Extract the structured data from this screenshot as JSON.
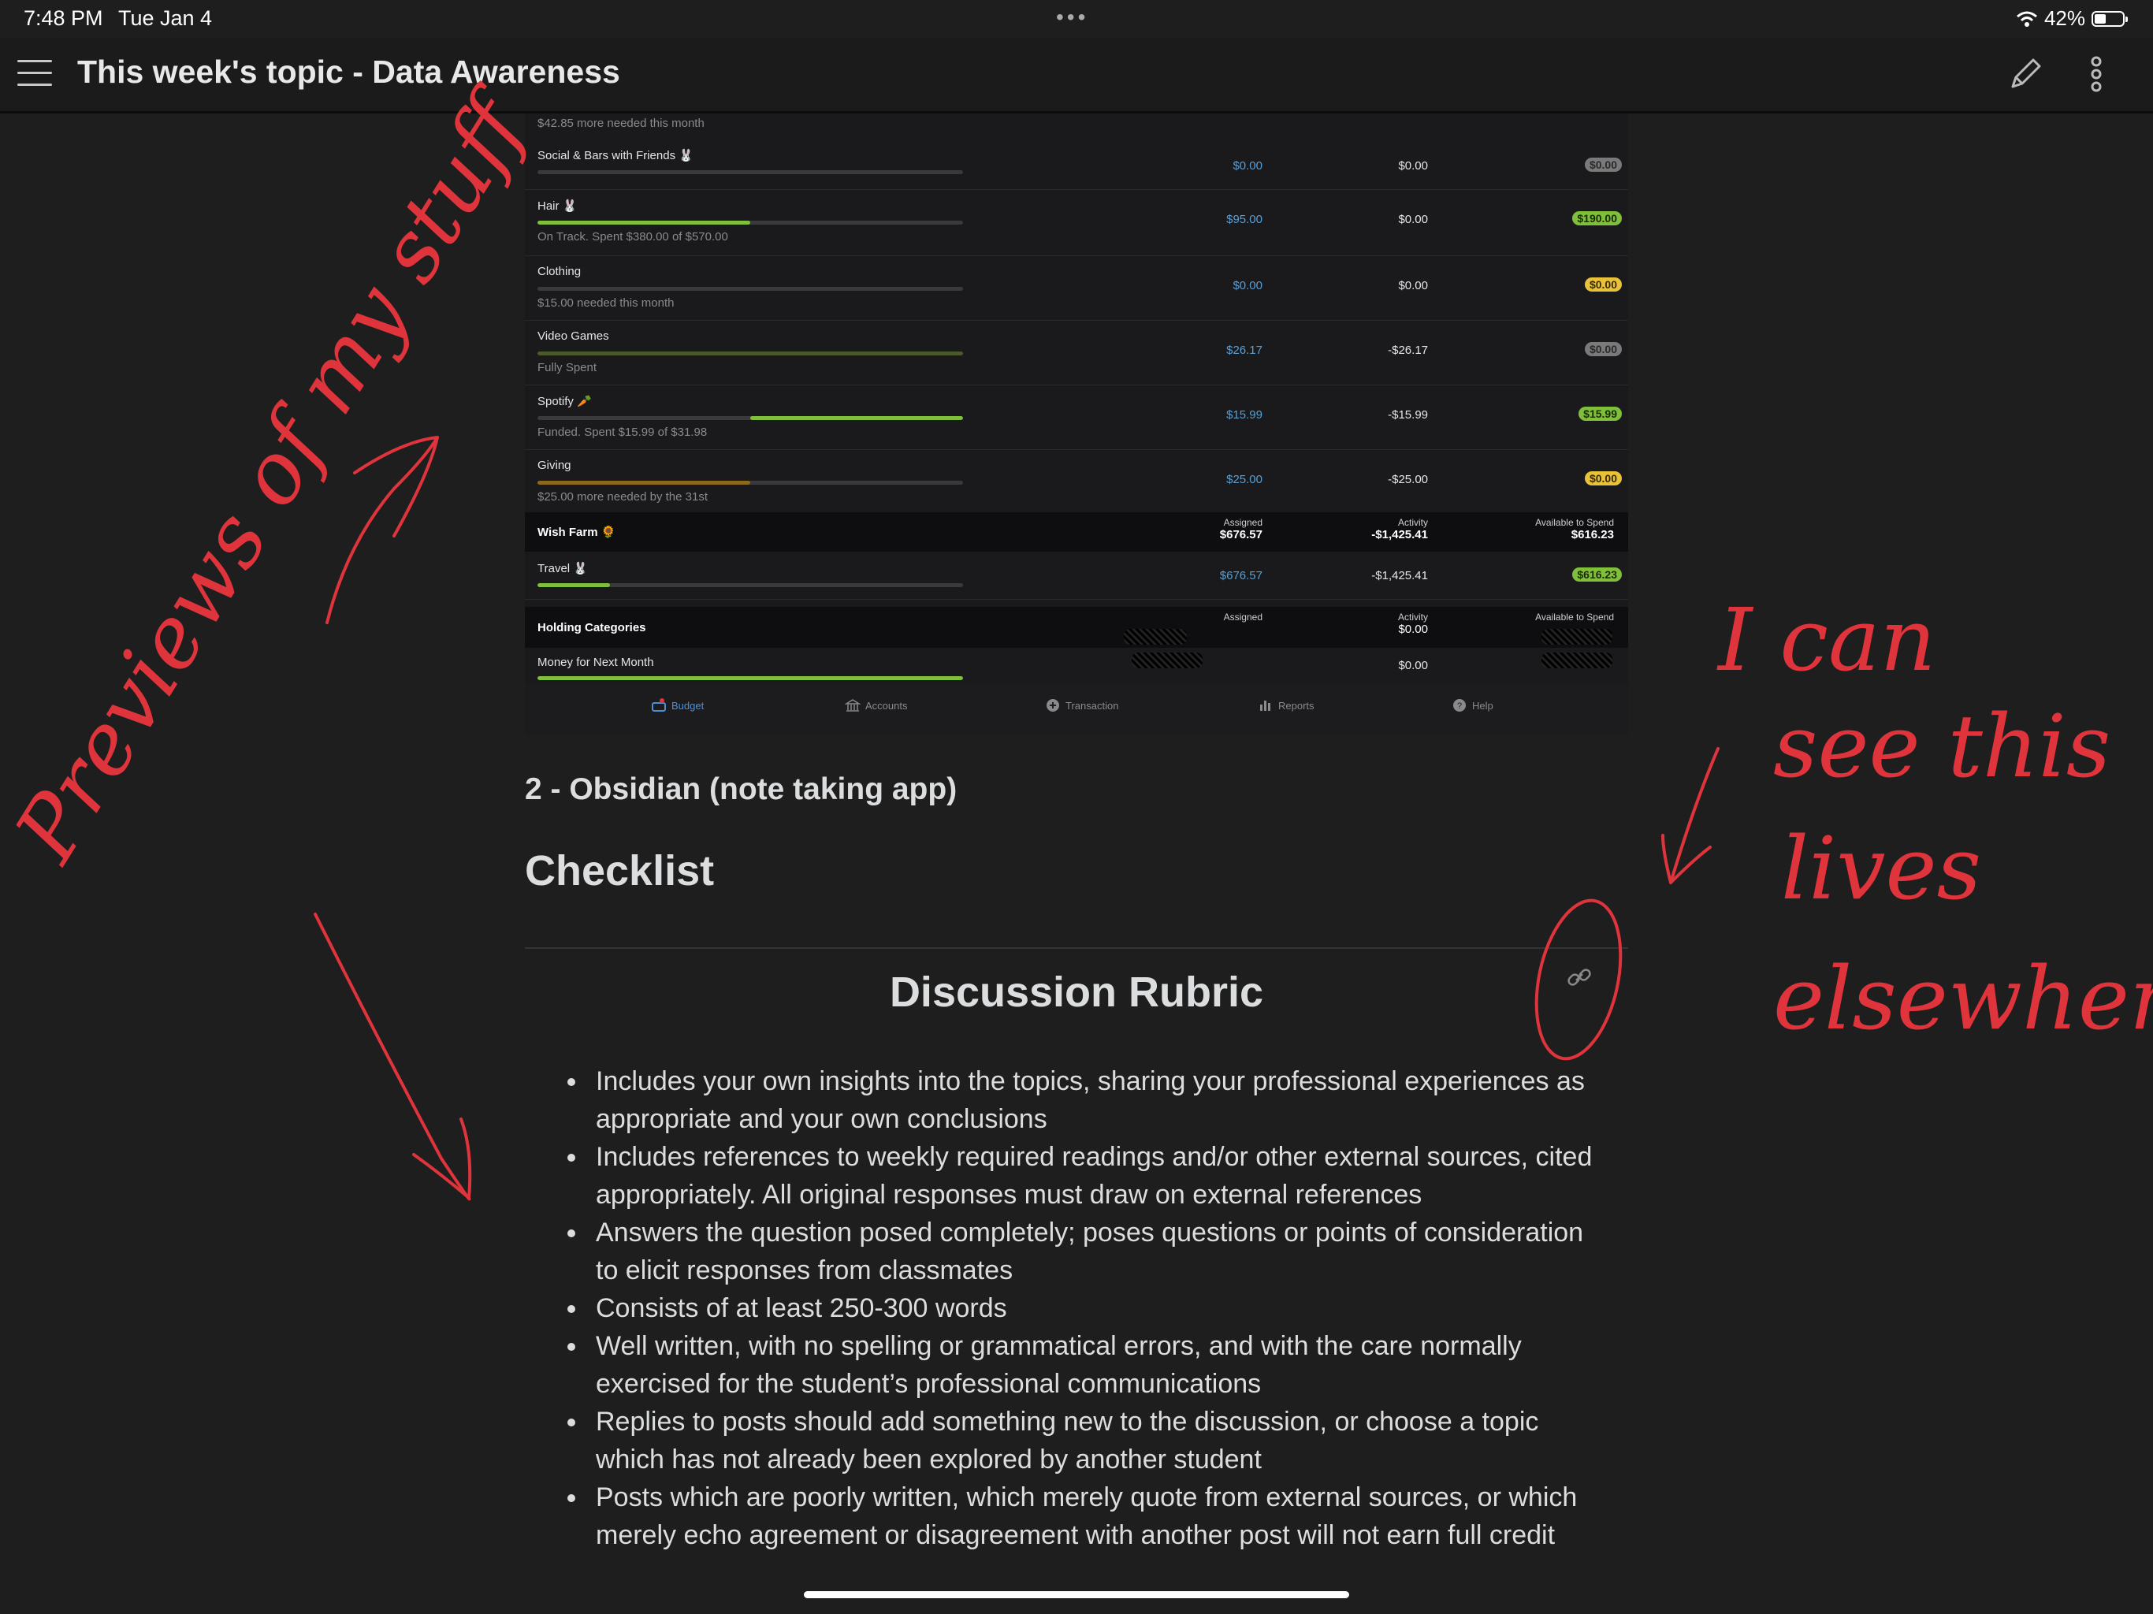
{
  "status": {
    "time": "7:48 PM",
    "date": "Tue Jan 4",
    "battery": "42%",
    "battery_level": 0.42
  },
  "header": {
    "title": "This week's topic - Data Awareness"
  },
  "budget": {
    "top_sub": "$42.85 more needed this month",
    "rows": [
      {
        "name": "Social & Bars with Friends 🐰",
        "sub": "",
        "assigned": "$0.00",
        "activity": "$0.00",
        "available": "$0.00",
        "pill": "gray",
        "progress": 0,
        "bar_color": "#3a3a3a"
      },
      {
        "name": "Hair 🐰",
        "sub": "On Track. Spent $380.00 of $570.00",
        "assigned": "$95.00",
        "activity": "$0.00",
        "available": "$190.00",
        "pill": "green",
        "progress": 0.5,
        "bar_color": "#7fbf3a"
      },
      {
        "name": "Clothing",
        "sub": "$15.00 needed this month",
        "assigned": "$0.00",
        "activity": "$0.00",
        "available": "$0.00",
        "pill": "yellow",
        "progress": 0,
        "bar_color": "#3a3a3a"
      },
      {
        "name": "Video Games",
        "sub": "Fully Spent",
        "assigned": "$26.17",
        "activity": "-$26.17",
        "available": "$0.00",
        "pill": "gray",
        "progress": 1,
        "bar_color": "#4a5a2a"
      },
      {
        "name": "Spotify 🥕",
        "sub": "Funded. Spent $15.99 of $31.98",
        "assigned": "$15.99",
        "activity": "-$15.99",
        "available": "$15.99",
        "pill": "green",
        "progress": 0.5,
        "bar_color": "#7fbf3a",
        "bar_offset": 0.5
      },
      {
        "name": "Giving",
        "sub": "$25.00 more needed by the 31st",
        "assigned": "$25.00",
        "activity": "-$25.00",
        "available": "$0.00",
        "pill": "yellow",
        "progress": 0.5,
        "bar_color": "#8a6a1a"
      }
    ],
    "wish_group": {
      "name": "Wish Farm 🌻",
      "assigned_label": "Assigned",
      "assigned": "$676.57",
      "activity_label": "Activity",
      "activity": "-$1,425.41",
      "available_label": "Available to Spend",
      "available": "$616.23"
    },
    "travel": {
      "name": "Travel 🐰",
      "assigned": "$676.57",
      "activity": "-$1,425.41",
      "available": "$616.23",
      "progress": 0.17
    },
    "holding_group": {
      "name": "Holding Categories",
      "assigned_label": "Assigned",
      "activity_label": "Activity",
      "activity": "$0.00",
      "available_label": "Available to Spend"
    },
    "money_next": {
      "name": "Money for Next Month",
      "activity": "$0.00"
    },
    "tabs": [
      {
        "label": "Budget",
        "badge": "1"
      },
      {
        "label": "Accounts"
      },
      {
        "label": "Transaction"
      },
      {
        "label": "Reports"
      },
      {
        "label": "Help"
      }
    ]
  },
  "note": {
    "h3": "2 - Obsidian (note taking app)",
    "h1": "Checklist",
    "rubric_title": "Discussion Rubric",
    "rubric": [
      "Includes your own insights into the topics, sharing your professional experiences as appropriate and your own conclusions",
      "Includes references to weekly required readings and/or other external sources, cited appropriately. All original responses must draw on external references",
      "Answers the question posed completely; poses questions or points of consideration to elicit responses from classmates",
      "Consists of at least 250-300 words",
      "Well written, with no spelling or grammatical errors, and with the care normally exercised for the student’s professional communications",
      "Replies to posts should add something new to the discussion, or choose a topic which has not already been explored by another student",
      "Posts which are poorly written, which merely quote from external sources, or which merely echo agreement or disagreement with another post will not earn full credit"
    ]
  },
  "annotations": {
    "color": "#e0343c",
    "left_text": "Previews of my stuff",
    "right_text": "I can see this lives elsewhere"
  }
}
